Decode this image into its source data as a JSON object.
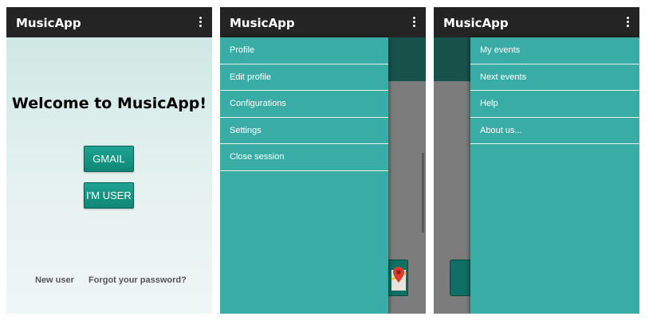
{
  "app": {
    "title": "MusicApp"
  },
  "welcome": {
    "heading": "Welcome to MusicApp!",
    "buttons": {
      "gmail": "GMAIL",
      "user": "I'M USER"
    },
    "links": {
      "new_user": "New user",
      "forgot": "Forgot your password?"
    }
  },
  "left_drawer": {
    "items": [
      "Profile",
      "Edit profile",
      "Configurations",
      "Settings",
      "Close session"
    ]
  },
  "right_menu": {
    "items": [
      "My events",
      "Next events",
      "Help",
      "About us..."
    ]
  },
  "colors": {
    "appbar": "#242424",
    "drawer": "#39ada5",
    "button": "#138c7c",
    "welcome_bg": "#d9eeea"
  },
  "icons": [
    "more-vert-icon",
    "map-pin-icon"
  ]
}
